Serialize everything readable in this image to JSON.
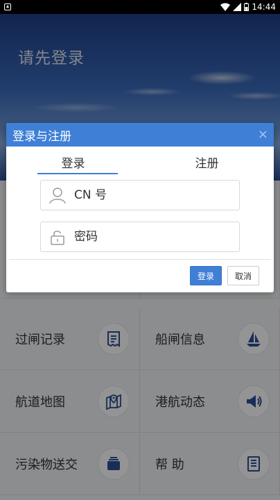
{
  "status_bar": {
    "time": "14:44"
  },
  "hero": {
    "title": "请先登录"
  },
  "menu": {
    "items": [
      {
        "label": "过闸记录",
        "icon": "receipt-icon"
      },
      {
        "label": "船闸信息",
        "icon": "sailboat-icon"
      },
      {
        "label": "航道地图",
        "icon": "map-pin-icon"
      },
      {
        "label": "港航动态",
        "icon": "megaphone-icon"
      },
      {
        "label": "污染物送交",
        "icon": "cards-icon"
      },
      {
        "label": "帮 助",
        "icon": "document-icon"
      }
    ]
  },
  "dialog": {
    "title": "登录与注册",
    "close_label": "×",
    "tabs": [
      {
        "label": "登录",
        "active": true
      },
      {
        "label": "注册",
        "active": false
      }
    ],
    "cn_field": {
      "placeholder": "CN 号",
      "value": ""
    },
    "password_field": {
      "placeholder": "密码",
      "value": ""
    },
    "login_button": "登录",
    "cancel_button": "取消"
  },
  "colors": {
    "accent": "#3f7fd6",
    "icon_blue": "#2b4f97",
    "overlay": "rgba(0,0,0,0.42)"
  }
}
